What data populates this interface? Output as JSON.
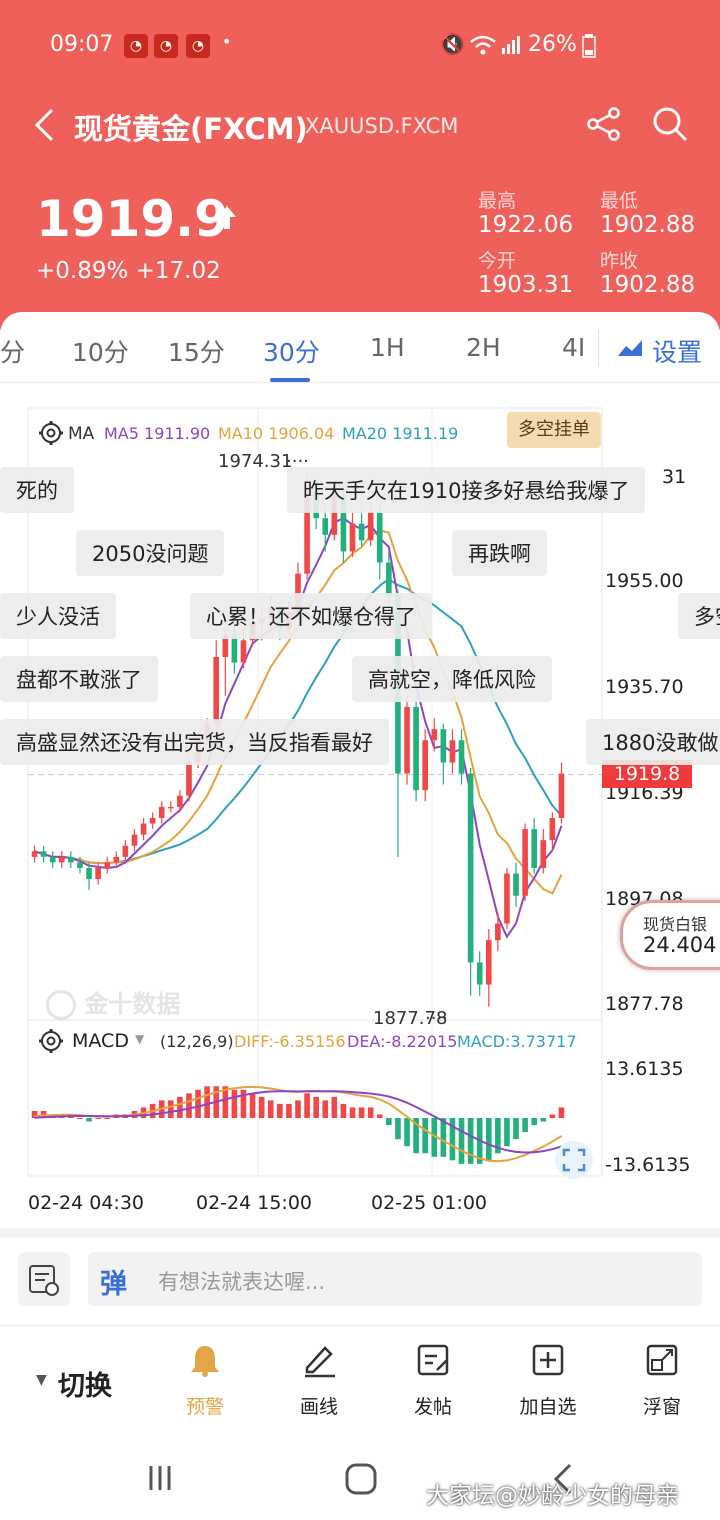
{
  "status_bar": {
    "time": "09:07",
    "battery": "26%",
    "dot": "•"
  },
  "nav": {
    "title": "现货黄金(FXCM)",
    "symbol": "XAUUSD.FXCM"
  },
  "quote": {
    "price": "1919.9",
    "change": "+0.89% +17.02",
    "high_label": "最高",
    "high": "1922.06",
    "low_label": "最低",
    "low": "1902.88",
    "open_label": "今开",
    "open": "1903.31",
    "prev_label": "昨收",
    "prev": "1902.88"
  },
  "tabs": [
    "分",
    "10分",
    "15分",
    "30分",
    "1H",
    "2H",
    "4I"
  ],
  "settings_label": "设置",
  "indicator": {
    "ma_label": "MA",
    "ma5": "MA5 1911.90",
    "ma10": "MA10 1906.04",
    "ma20": "MA20 1911.19",
    "order_button": "多空挂单",
    "high_marker": "1974.31",
    "low_marker": "1877.78",
    "watermark": "金十数据",
    "current_price": "1919.8"
  },
  "y_axis": [
    "1955.00",
    "1935.70",
    "1916.39",
    "1897.08",
    "1877.78"
  ],
  "y_axis_top_partial": "31",
  "silver": {
    "label": "现货白银",
    "value": "24.404"
  },
  "danmu": [
    "死的",
    "昨天手欠在1910接多好悬给我爆了",
    "2050没问题",
    "再跌啊",
    "少人没活",
    "心累！还不如爆仓得了",
    "多空",
    "盘都不敢涨了",
    "高就空，降低风险",
    "高盛显然还没有出完货，当反指看最好",
    "1880没敢做"
  ],
  "macd": {
    "label": "MACD",
    "params": "(12,26,9)",
    "diff": "DIFF:-6.35156",
    "dea": "DEA:-8.22015",
    "macd": "MACD:3.73717",
    "y_top": "13.6135",
    "y_bottom": "-13.6135"
  },
  "x_axis": [
    "02-24 04:30",
    "02-24 15:00",
    "02-25 01:00"
  ],
  "comment_placeholder": "有想法就表达喔...",
  "bottom_bar": {
    "switch": "切换",
    "items": [
      "预警",
      "画线",
      "发帖",
      "加自选",
      "浮窗"
    ]
  },
  "watermark_user": "大家坛@妙龄少女的母亲",
  "colors": {
    "header": "#f0605a",
    "up": "#f04848",
    "down": "#22b07d",
    "ma5": "#8e44c8",
    "ma10": "#e6a23c",
    "ma20": "#2f9fc0",
    "tab_active": "#3a6fd6"
  },
  "chart_data": {
    "type": "candlestick",
    "candles": [
      [
        1905,
        1906,
        1904,
        1907
      ],
      [
        1906,
        1905,
        1904,
        1907
      ],
      [
        1905,
        1904,
        1903,
        1906
      ],
      [
        1904,
        1905,
        1903,
        1906
      ],
      [
        1905,
        1904,
        1903,
        1906
      ],
      [
        1904,
        1903,
        1902,
        1905
      ],
      [
        1903,
        1901,
        1899,
        1904
      ],
      [
        1901,
        1903,
        1900,
        1904
      ],
      [
        1903,
        1904,
        1902,
        1905
      ],
      [
        1904,
        1905,
        1903,
        1906
      ],
      [
        1905,
        1907,
        1904,
        1908
      ],
      [
        1907,
        1909,
        1906,
        1910
      ],
      [
        1909,
        1911,
        1908,
        1912
      ],
      [
        1911,
        1912,
        1910,
        1913
      ],
      [
        1912,
        1914,
        1911,
        1915
      ],
      [
        1914,
        1914,
        1913,
        1915
      ],
      [
        1914,
        1916,
        1913,
        1917
      ],
      [
        1916,
        1922,
        1915,
        1923
      ],
      [
        1922,
        1926,
        1921,
        1927
      ],
      [
        1926,
        1929,
        1925,
        1930
      ],
      [
        1929,
        1941,
        1928,
        1944
      ],
      [
        1941,
        1945,
        1934,
        1946
      ],
      [
        1945,
        1940,
        1938,
        1947
      ],
      [
        1940,
        1944,
        1939,
        1946
      ],
      [
        1944,
        1947,
        1943,
        1949
      ],
      [
        1947,
        1948,
        1944,
        1950
      ],
      [
        1948,
        1950,
        1946,
        1952
      ],
      [
        1950,
        1946,
        1944,
        1951
      ],
      [
        1946,
        1949,
        1945,
        1951
      ],
      [
        1949,
        1956,
        1948,
        1958
      ],
      [
        1956,
        1971,
        1955,
        1974
      ],
      [
        1971,
        1966,
        1964,
        1973
      ],
      [
        1966,
        1963,
        1960,
        1968
      ],
      [
        1963,
        1970,
        1962,
        1972
      ],
      [
        1970,
        1960,
        1958,
        1971
      ],
      [
        1960,
        1965,
        1959,
        1967
      ],
      [
        1965,
        1962,
        1961,
        1968
      ],
      [
        1962,
        1967,
        1961,
        1969
      ],
      [
        1967,
        1958,
        1955,
        1969
      ],
      [
        1958,
        1952,
        1950,
        1960
      ],
      [
        1952,
        1920,
        1905,
        1953
      ],
      [
        1920,
        1932,
        1918,
        1934
      ],
      [
        1932,
        1917,
        1915,
        1934
      ],
      [
        1917,
        1926,
        1915,
        1928
      ],
      [
        1926,
        1928,
        1924,
        1930
      ],
      [
        1928,
        1922,
        1918,
        1929
      ],
      [
        1922,
        1926,
        1920,
        1928
      ],
      [
        1926,
        1920,
        1918,
        1928
      ],
      [
        1920,
        1886,
        1880,
        1921
      ],
      [
        1886,
        1882,
        1880,
        1888
      ],
      [
        1882,
        1890,
        1878,
        1892
      ],
      [
        1890,
        1893,
        1888,
        1895
      ],
      [
        1893,
        1902,
        1892,
        1903
      ],
      [
        1902,
        1898,
        1896,
        1904
      ],
      [
        1898,
        1910,
        1897,
        1911
      ],
      [
        1910,
        1903,
        1902,
        1912
      ],
      [
        1903,
        1908,
        1902,
        1910
      ],
      [
        1908,
        1912,
        1906,
        1913
      ],
      [
        1912,
        1920,
        1911,
        1922
      ]
    ],
    "ylim": [
      1877.78,
      1974.31
    ],
    "macd_hist": [
      2,
      2,
      1,
      1,
      1,
      0,
      -1,
      0,
      0,
      1,
      1,
      2,
      3,
      4,
      5,
      5,
      6,
      7,
      8,
      9,
      9,
      9,
      8,
      8,
      7,
      6,
      5,
      4,
      4,
      5,
      7,
      6,
      5,
      6,
      4,
      3,
      3,
      3,
      1,
      -2,
      -6,
      -8,
      -10,
      -10,
      -11,
      -11,
      -12,
      -13,
      -13,
      -13,
      -12,
      -10,
      -8,
      -6,
      -4,
      -2,
      -1,
      1,
      3
    ],
    "macd_ylim": [
      -13.6135,
      13.6135
    ]
  }
}
